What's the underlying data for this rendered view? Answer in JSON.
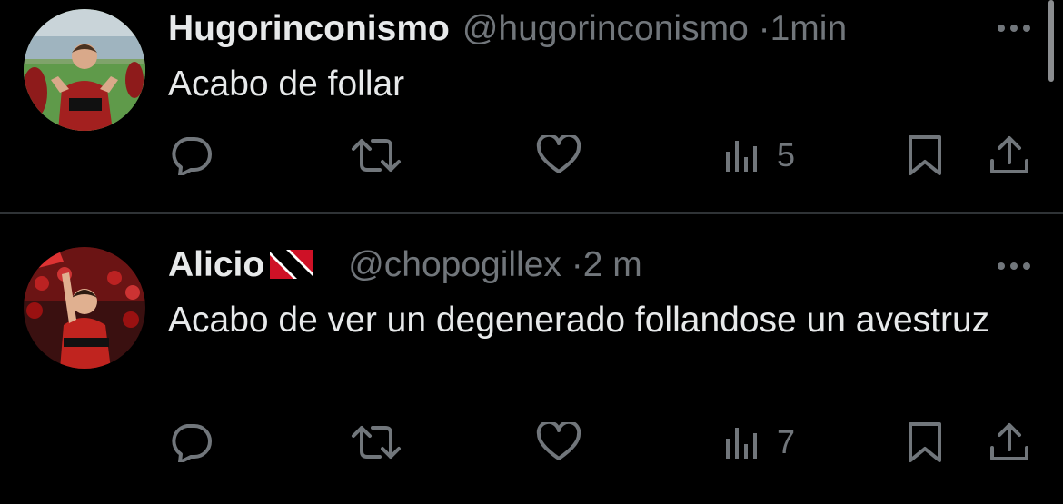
{
  "tweets": [
    {
      "display_name": "Hugorinconismo",
      "handle": "@hugorinconismo",
      "separator": "·",
      "time": "1min",
      "text": "Acabo de follar",
      "avatar": "avatar-photo-football-player",
      "views": "5"
    },
    {
      "display_name": "Alicio",
      "flag": "trinidad-and-tobago-flag-icon",
      "handle": "@chopogillex",
      "separator": "·",
      "time": "2 m",
      "text": "Acabo de ver un degenerado follandose un avestruz",
      "avatar": "avatar-photo-football-celebration",
      "views": "7"
    }
  ],
  "icons": {
    "reply": "reply-icon",
    "retweet": "retweet-icon",
    "like": "heart-icon",
    "views": "views-icon",
    "bookmark": "bookmark-icon",
    "share": "share-icon",
    "more": "more-icon"
  },
  "colors": {
    "background": "#000000",
    "primary_text": "#e7e9ea",
    "secondary_text": "#71767b",
    "divider": "#2f3336"
  }
}
